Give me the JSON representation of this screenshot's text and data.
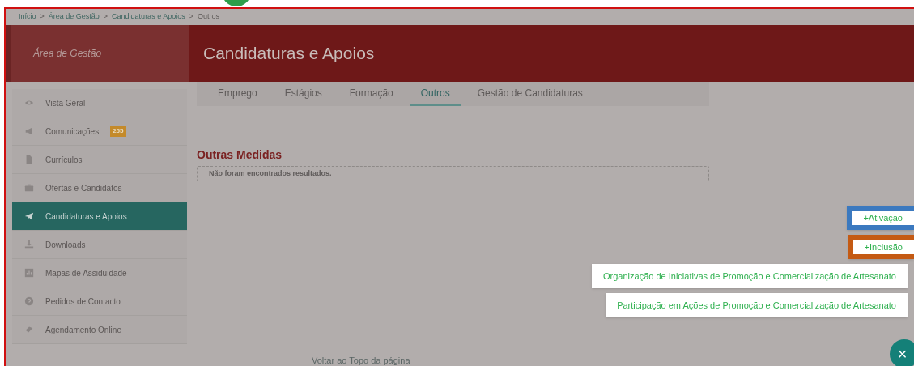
{
  "breadcrumb": [
    {
      "label": "Início",
      "link": true
    },
    {
      "label": "Área de Gestão",
      "link": true
    },
    {
      "label": "Candidaturas e Apoios",
      "link": true
    },
    {
      "label": "Outros",
      "link": false
    }
  ],
  "breadcrumb_separator": ">",
  "sidebar": {
    "title": "Área de Gestão",
    "items": [
      {
        "label": "Vista Geral",
        "selected": false
      },
      {
        "label": "Comunicações",
        "selected": false,
        "badge": "255"
      },
      {
        "label": "Currículos",
        "selected": false
      },
      {
        "label": "Ofertas e Candidatos",
        "selected": false
      },
      {
        "label": "Candidaturas e Apoios",
        "selected": true
      },
      {
        "label": "Downloads",
        "selected": false
      },
      {
        "label": "Mapas de Assiduidade",
        "selected": false
      },
      {
        "label": "Pedidos de Contacto",
        "selected": false
      },
      {
        "label": "Agendamento Online",
        "selected": false
      }
    ]
  },
  "page_title": "Candidaturas e Apoios",
  "tabs": [
    {
      "label": "Emprego",
      "selected": false
    },
    {
      "label": "Estágios",
      "selected": false
    },
    {
      "label": "Formação",
      "selected": false
    },
    {
      "label": "Outros",
      "selected": true
    },
    {
      "label": "Gestão de Candidaturas",
      "selected": false
    }
  ],
  "section": {
    "title": "Outras Medidas",
    "empty_message": "Não foram encontrados resultados."
  },
  "floating_buttons": [
    {
      "label": "+Ativação",
      "color": "#3b79bf"
    },
    {
      "label": "+Inclusão",
      "color": "#c45a13"
    },
    {
      "label": "Organização de Iniciativas de Promoção e Comercialização de Artesanato"
    },
    {
      "label": "Participação em Ações de Promoção e Comercialização de Artesanato"
    }
  ],
  "footer": {
    "back_to_top": "Voltar ao Topo da página"
  },
  "close_button": "×"
}
